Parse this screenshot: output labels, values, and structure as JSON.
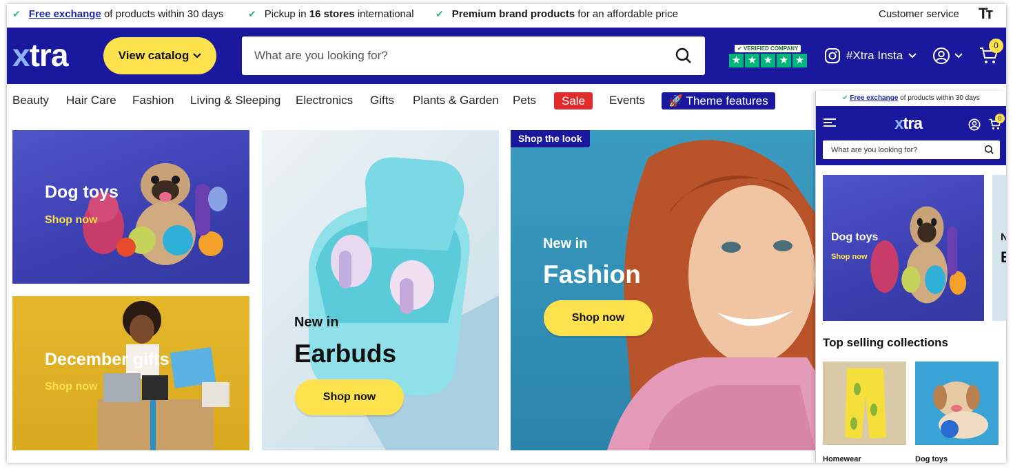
{
  "usp": {
    "item1_link": "Free exchange",
    "item1_text": " of products within 30 days",
    "item2_pre": "Pickup in ",
    "item2_bold": "16 stores",
    "item2_post": " international",
    "item3_bold": "Premium brand products",
    "item3_post": " for an affordable price",
    "customer_service": "Customer service",
    "text_size_icon": "Tт"
  },
  "header": {
    "logo_x": "x",
    "logo_rest": "tra",
    "catalog_label": "View catalog",
    "search_placeholder": "What are you looking for?",
    "trust_label": "VERIFIED COMPANY",
    "insta_label": "#Xtra Insta",
    "cart_count": "0"
  },
  "nav": {
    "items": [
      "Beauty",
      "Hair Care",
      "Fashion",
      "Living & Sleeping",
      "Electronics",
      "Gifts",
      "Plants & Garden",
      "Pets",
      "Sale",
      "Events"
    ],
    "theme_label": "🚀 Theme features"
  },
  "tiles": {
    "dog": {
      "title": "Dog toys",
      "link": "Shop now"
    },
    "gifts": {
      "title": "December gifts",
      "link": "Shop now"
    },
    "earbuds": {
      "kicker": "New in",
      "title": "Earbuds",
      "cta": "Shop now"
    },
    "fashion": {
      "tag": "Shop the look",
      "kicker": "New in",
      "title": "Fashion",
      "cta": "Shop now"
    }
  },
  "mobile": {
    "usp_link": "Free exchange",
    "usp_text": " of products within 30 days",
    "logo_x": "x",
    "logo_rest": "tra",
    "cart_count": "0",
    "search_placeholder": "What are you looking for?",
    "tile_title": "Dog toys",
    "tile_link": "Shop now",
    "peek_letter1": "N",
    "peek_letter2": "E",
    "section_title": "Top selling collections",
    "collections": [
      "Homewear",
      "Dog toys"
    ]
  },
  "colors": {
    "brand_blue": "#1a189c",
    "accent_yellow": "#fde24d",
    "sale_red": "#e02c2c",
    "check_green": "#36b37e"
  }
}
